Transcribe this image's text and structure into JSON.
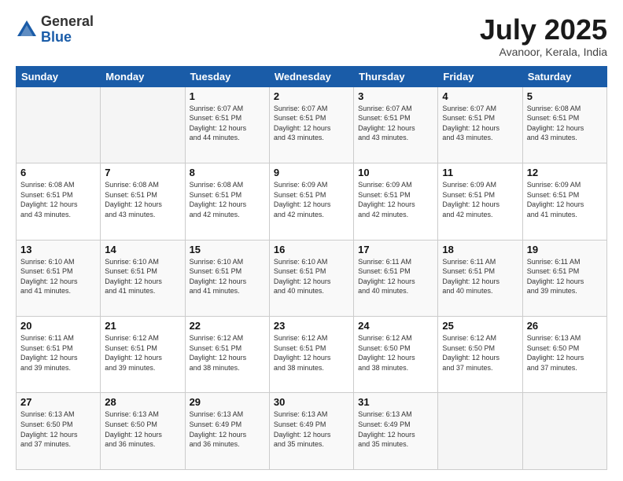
{
  "header": {
    "logo_general": "General",
    "logo_blue": "Blue",
    "month_title": "July 2025",
    "location": "Avanoor, Kerala, India"
  },
  "weekdays": [
    "Sunday",
    "Monday",
    "Tuesday",
    "Wednesday",
    "Thursday",
    "Friday",
    "Saturday"
  ],
  "weeks": [
    [
      {
        "day": "",
        "info": ""
      },
      {
        "day": "",
        "info": ""
      },
      {
        "day": "1",
        "info": "Sunrise: 6:07 AM\nSunset: 6:51 PM\nDaylight: 12 hours\nand 44 minutes."
      },
      {
        "day": "2",
        "info": "Sunrise: 6:07 AM\nSunset: 6:51 PM\nDaylight: 12 hours\nand 43 minutes."
      },
      {
        "day": "3",
        "info": "Sunrise: 6:07 AM\nSunset: 6:51 PM\nDaylight: 12 hours\nand 43 minutes."
      },
      {
        "day": "4",
        "info": "Sunrise: 6:07 AM\nSunset: 6:51 PM\nDaylight: 12 hours\nand 43 minutes."
      },
      {
        "day": "5",
        "info": "Sunrise: 6:08 AM\nSunset: 6:51 PM\nDaylight: 12 hours\nand 43 minutes."
      }
    ],
    [
      {
        "day": "6",
        "info": "Sunrise: 6:08 AM\nSunset: 6:51 PM\nDaylight: 12 hours\nand 43 minutes."
      },
      {
        "day": "7",
        "info": "Sunrise: 6:08 AM\nSunset: 6:51 PM\nDaylight: 12 hours\nand 43 minutes."
      },
      {
        "day": "8",
        "info": "Sunrise: 6:08 AM\nSunset: 6:51 PM\nDaylight: 12 hours\nand 42 minutes."
      },
      {
        "day": "9",
        "info": "Sunrise: 6:09 AM\nSunset: 6:51 PM\nDaylight: 12 hours\nand 42 minutes."
      },
      {
        "day": "10",
        "info": "Sunrise: 6:09 AM\nSunset: 6:51 PM\nDaylight: 12 hours\nand 42 minutes."
      },
      {
        "day": "11",
        "info": "Sunrise: 6:09 AM\nSunset: 6:51 PM\nDaylight: 12 hours\nand 42 minutes."
      },
      {
        "day": "12",
        "info": "Sunrise: 6:09 AM\nSunset: 6:51 PM\nDaylight: 12 hours\nand 41 minutes."
      }
    ],
    [
      {
        "day": "13",
        "info": "Sunrise: 6:10 AM\nSunset: 6:51 PM\nDaylight: 12 hours\nand 41 minutes."
      },
      {
        "day": "14",
        "info": "Sunrise: 6:10 AM\nSunset: 6:51 PM\nDaylight: 12 hours\nand 41 minutes."
      },
      {
        "day": "15",
        "info": "Sunrise: 6:10 AM\nSunset: 6:51 PM\nDaylight: 12 hours\nand 41 minutes."
      },
      {
        "day": "16",
        "info": "Sunrise: 6:10 AM\nSunset: 6:51 PM\nDaylight: 12 hours\nand 40 minutes."
      },
      {
        "day": "17",
        "info": "Sunrise: 6:11 AM\nSunset: 6:51 PM\nDaylight: 12 hours\nand 40 minutes."
      },
      {
        "day": "18",
        "info": "Sunrise: 6:11 AM\nSunset: 6:51 PM\nDaylight: 12 hours\nand 40 minutes."
      },
      {
        "day": "19",
        "info": "Sunrise: 6:11 AM\nSunset: 6:51 PM\nDaylight: 12 hours\nand 39 minutes."
      }
    ],
    [
      {
        "day": "20",
        "info": "Sunrise: 6:11 AM\nSunset: 6:51 PM\nDaylight: 12 hours\nand 39 minutes."
      },
      {
        "day": "21",
        "info": "Sunrise: 6:12 AM\nSunset: 6:51 PM\nDaylight: 12 hours\nand 39 minutes."
      },
      {
        "day": "22",
        "info": "Sunrise: 6:12 AM\nSunset: 6:51 PM\nDaylight: 12 hours\nand 38 minutes."
      },
      {
        "day": "23",
        "info": "Sunrise: 6:12 AM\nSunset: 6:51 PM\nDaylight: 12 hours\nand 38 minutes."
      },
      {
        "day": "24",
        "info": "Sunrise: 6:12 AM\nSunset: 6:50 PM\nDaylight: 12 hours\nand 38 minutes."
      },
      {
        "day": "25",
        "info": "Sunrise: 6:12 AM\nSunset: 6:50 PM\nDaylight: 12 hours\nand 37 minutes."
      },
      {
        "day": "26",
        "info": "Sunrise: 6:13 AM\nSunset: 6:50 PM\nDaylight: 12 hours\nand 37 minutes."
      }
    ],
    [
      {
        "day": "27",
        "info": "Sunrise: 6:13 AM\nSunset: 6:50 PM\nDaylight: 12 hours\nand 37 minutes."
      },
      {
        "day": "28",
        "info": "Sunrise: 6:13 AM\nSunset: 6:50 PM\nDaylight: 12 hours\nand 36 minutes."
      },
      {
        "day": "29",
        "info": "Sunrise: 6:13 AM\nSunset: 6:49 PM\nDaylight: 12 hours\nand 36 minutes."
      },
      {
        "day": "30",
        "info": "Sunrise: 6:13 AM\nSunset: 6:49 PM\nDaylight: 12 hours\nand 35 minutes."
      },
      {
        "day": "31",
        "info": "Sunrise: 6:13 AM\nSunset: 6:49 PM\nDaylight: 12 hours\nand 35 minutes."
      },
      {
        "day": "",
        "info": ""
      },
      {
        "day": "",
        "info": ""
      }
    ]
  ]
}
